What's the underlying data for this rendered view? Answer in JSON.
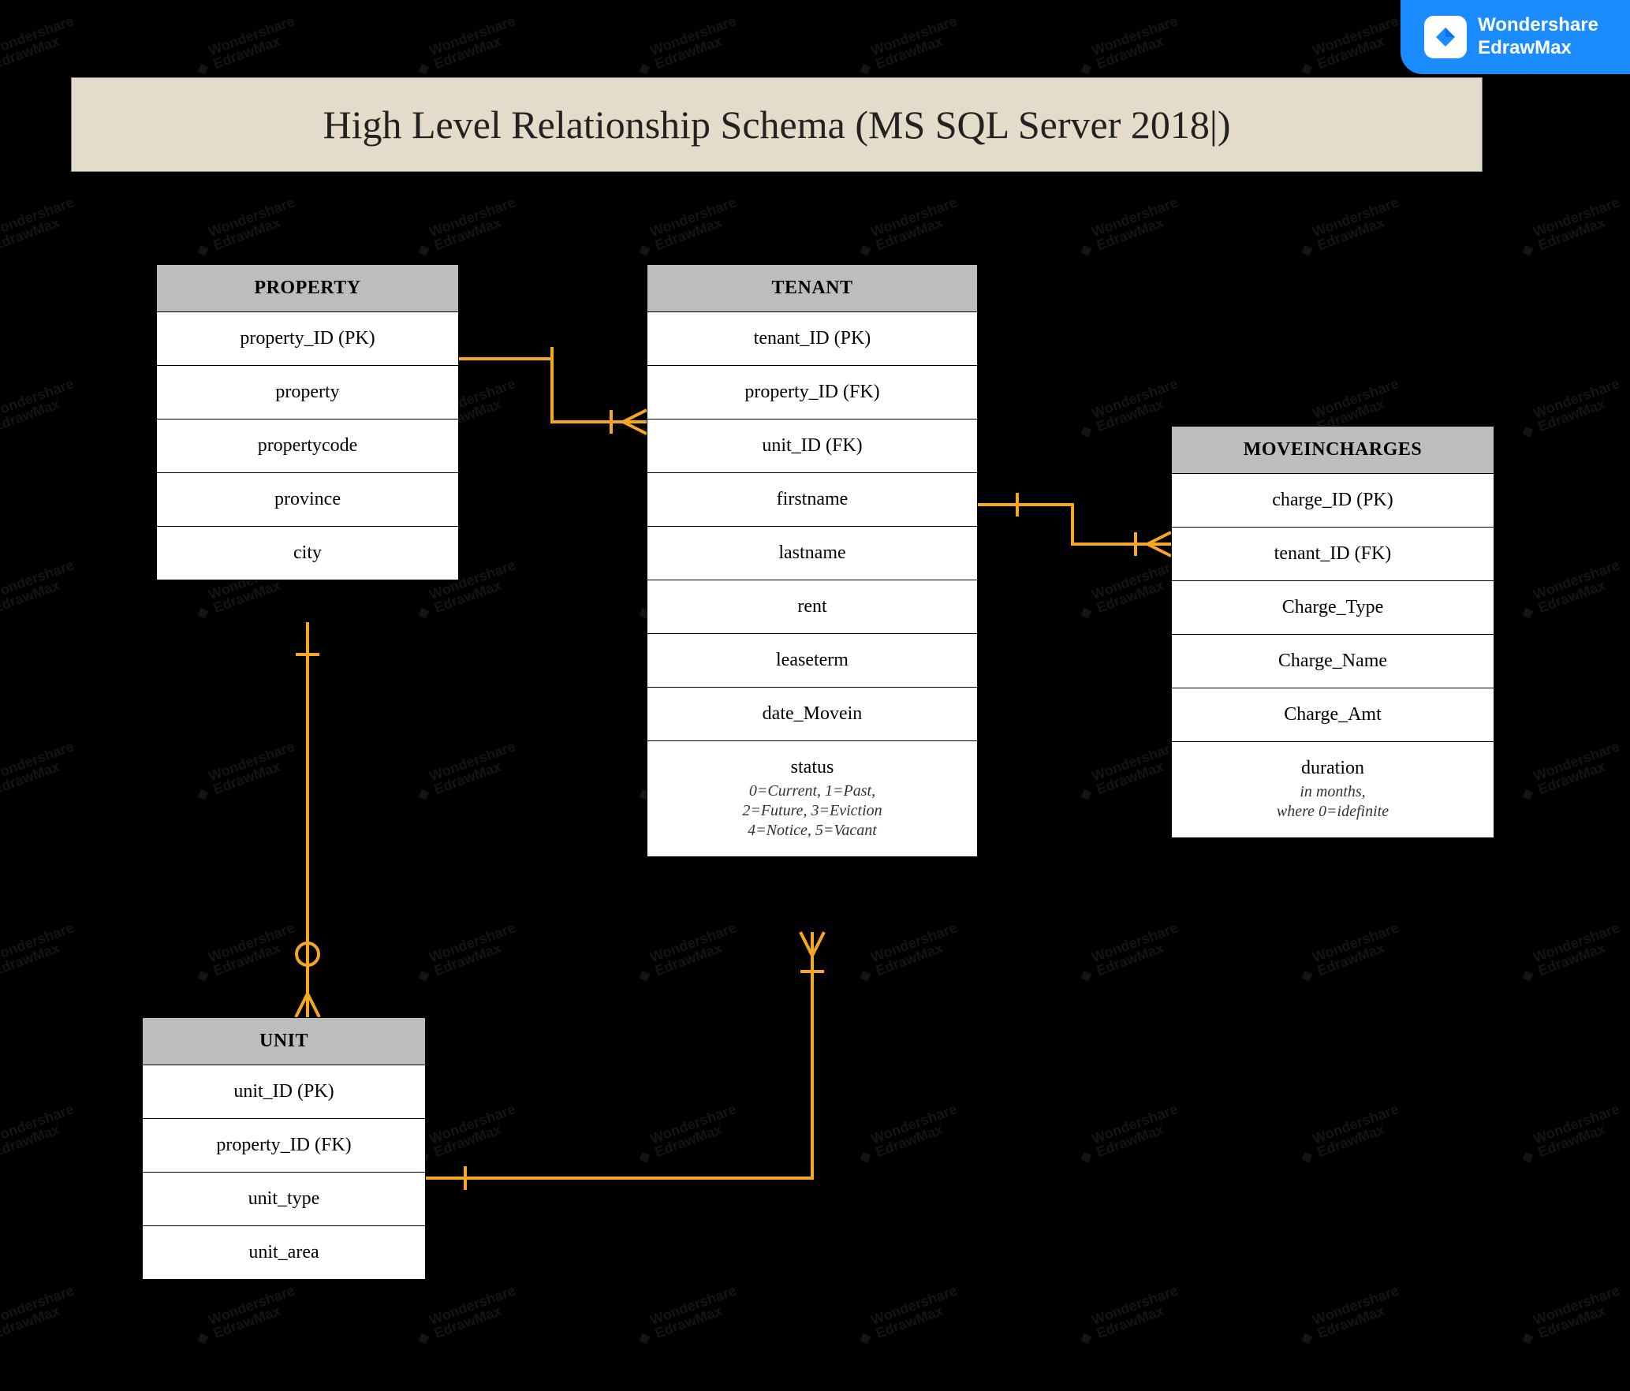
{
  "badge": {
    "line1": "Wondershare",
    "line2": "EdrawMax"
  },
  "watermark": "Wondershare EdrawMax",
  "title": "High Level Relationship Schema (MS SQL Server 2018|)",
  "entities": {
    "property": {
      "name": "PROPERTY",
      "rows": [
        {
          "text": "property_ID (PK)"
        },
        {
          "text": "property"
        },
        {
          "text": "propertycode"
        },
        {
          "text": "province"
        },
        {
          "text": "city"
        }
      ]
    },
    "tenant": {
      "name": "TENANT",
      "rows": [
        {
          "text": "tenant_ID (PK)"
        },
        {
          "text": "property_ID (FK)"
        },
        {
          "text": "unit_ID (FK)"
        },
        {
          "text": "firstname"
        },
        {
          "text": "lastname"
        },
        {
          "text": "rent"
        },
        {
          "text": "leaseterm"
        },
        {
          "text": "date_Movein"
        },
        {
          "text": "status",
          "note": "0=Current, 1=Past,\n2=Future, 3=Eviction\n4=Notice, 5=Vacant"
        }
      ]
    },
    "moveincharges": {
      "name": "MOVEINCHARGES",
      "rows": [
        {
          "text": "charge_ID (PK)"
        },
        {
          "text": "tenant_ID (FK)"
        },
        {
          "text": "Charge_Type"
        },
        {
          "text": "Charge_Name"
        },
        {
          "text": "Charge_Amt"
        },
        {
          "text": "duration",
          "note": "in months,\nwhere 0=idefinite"
        }
      ]
    },
    "unit": {
      "name": "UNIT",
      "rows": [
        {
          "text": "unit_ID (PK)"
        },
        {
          "text": "property_ID (FK)"
        },
        {
          "text": "unit_type"
        },
        {
          "text": "unit_area"
        }
      ]
    }
  },
  "relationships": [
    {
      "from": "PROPERTY",
      "to": "TENANT",
      "notation": "one-to-many"
    },
    {
      "from": "TENANT",
      "to": "MOVEINCHARGES",
      "notation": "one-to-many"
    },
    {
      "from": "PROPERTY",
      "to": "UNIT",
      "notation": "one-to-many (optional)"
    },
    {
      "from": "UNIT",
      "to": "TENANT",
      "notation": "one-to-many"
    }
  ]
}
